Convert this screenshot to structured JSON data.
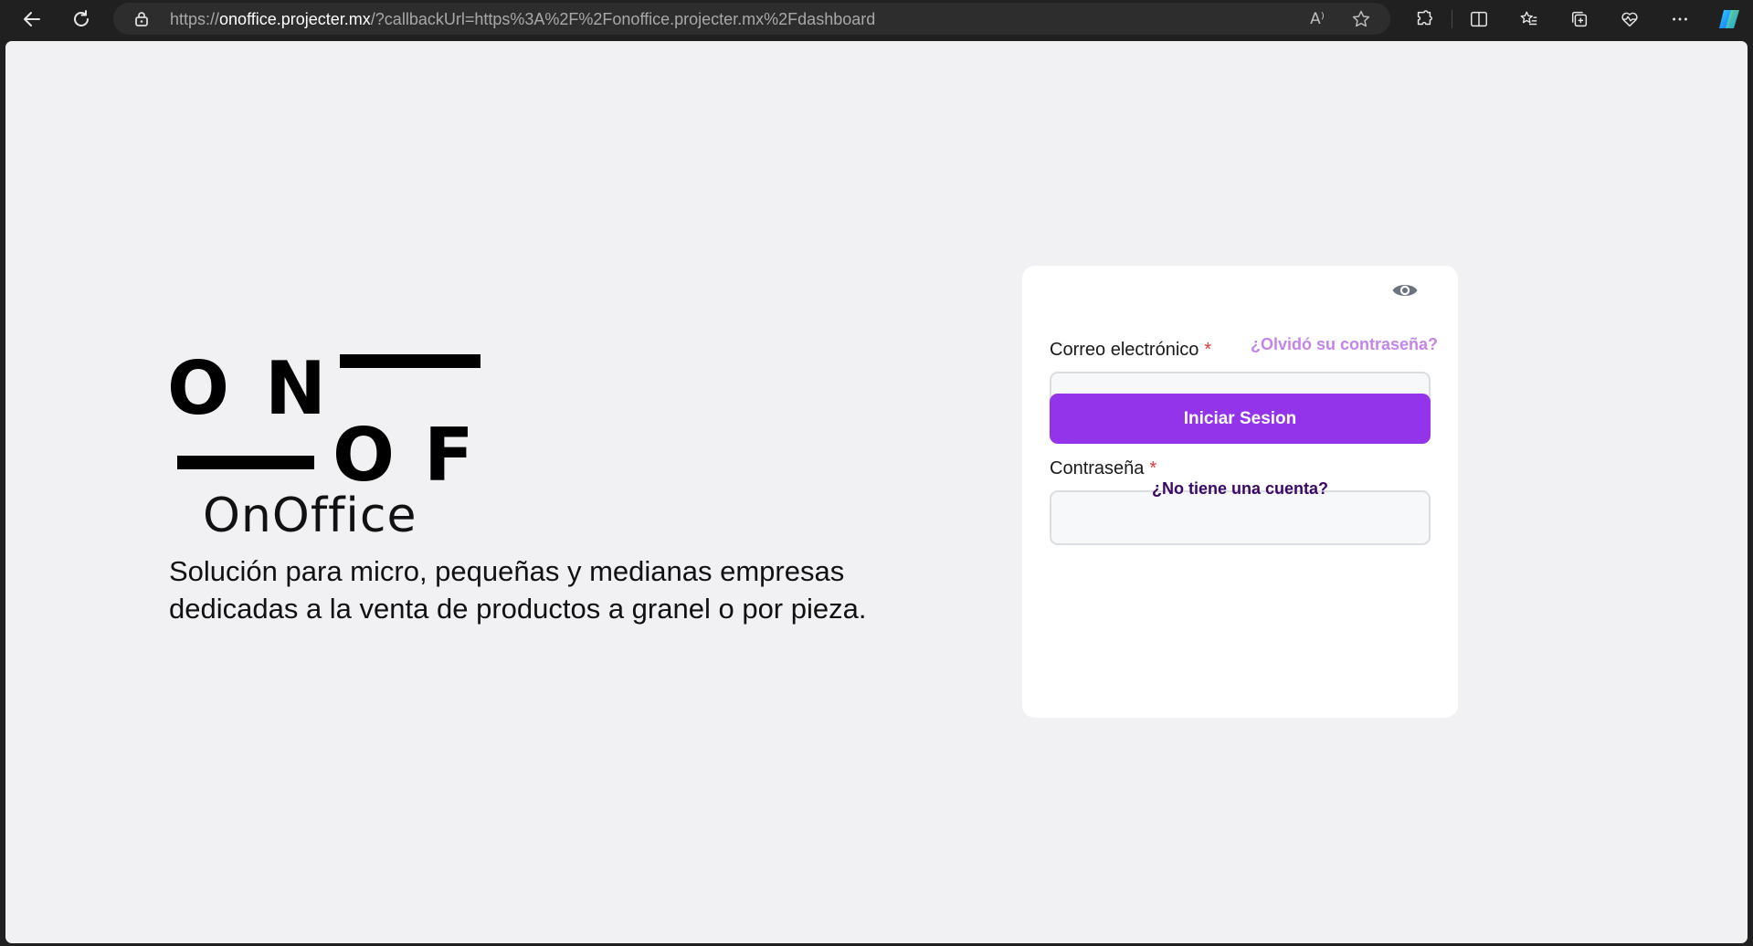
{
  "browser": {
    "url_scheme": "https://",
    "url_host": "onoffice.projecter.mx",
    "url_rest": "/?callbackUrl=https%3A%2F%2Fonoffice.projecter.mx%2Fdashboard",
    "read_aloud_glyph": "A⁾"
  },
  "hero": {
    "logo_letters": [
      "O",
      "N",
      "O",
      "F"
    ],
    "brand_name": "OnOffice",
    "tagline_line1": "Solución para micro, pequeñas y medianas empresas",
    "tagline_line2": "dedicadas a la venta de productos a granel o por pieza."
  },
  "login": {
    "email_label": "Correo electrónico",
    "email_value": "",
    "password_label": "Contraseña",
    "password_value": "",
    "required_mark": "*",
    "forgot_link": "¿Olvidó su contraseña?",
    "submit_label": "Iniciar Sesion",
    "signup_link": "¿No tiene una cuenta?"
  },
  "colors": {
    "accent": "#9333ea",
    "forgot_link": "#c485ea",
    "signup_link": "#3b0764",
    "required": "#e53939",
    "page_background": "#f1f1f4"
  },
  "icons": {
    "back": "back-arrow-icon",
    "refresh": "refresh-icon",
    "lock": "lock-icon",
    "read_aloud": "read-aloud-icon",
    "favorite": "star-icon",
    "extensions": "puzzle-icon",
    "split_screen": "split-screen-icon",
    "favorites": "favorites-icon",
    "collections": "collections-icon",
    "health": "heart-pulse-icon",
    "more": "more-icon",
    "copilot": "copilot-icon",
    "show_password": "eye-icon"
  }
}
